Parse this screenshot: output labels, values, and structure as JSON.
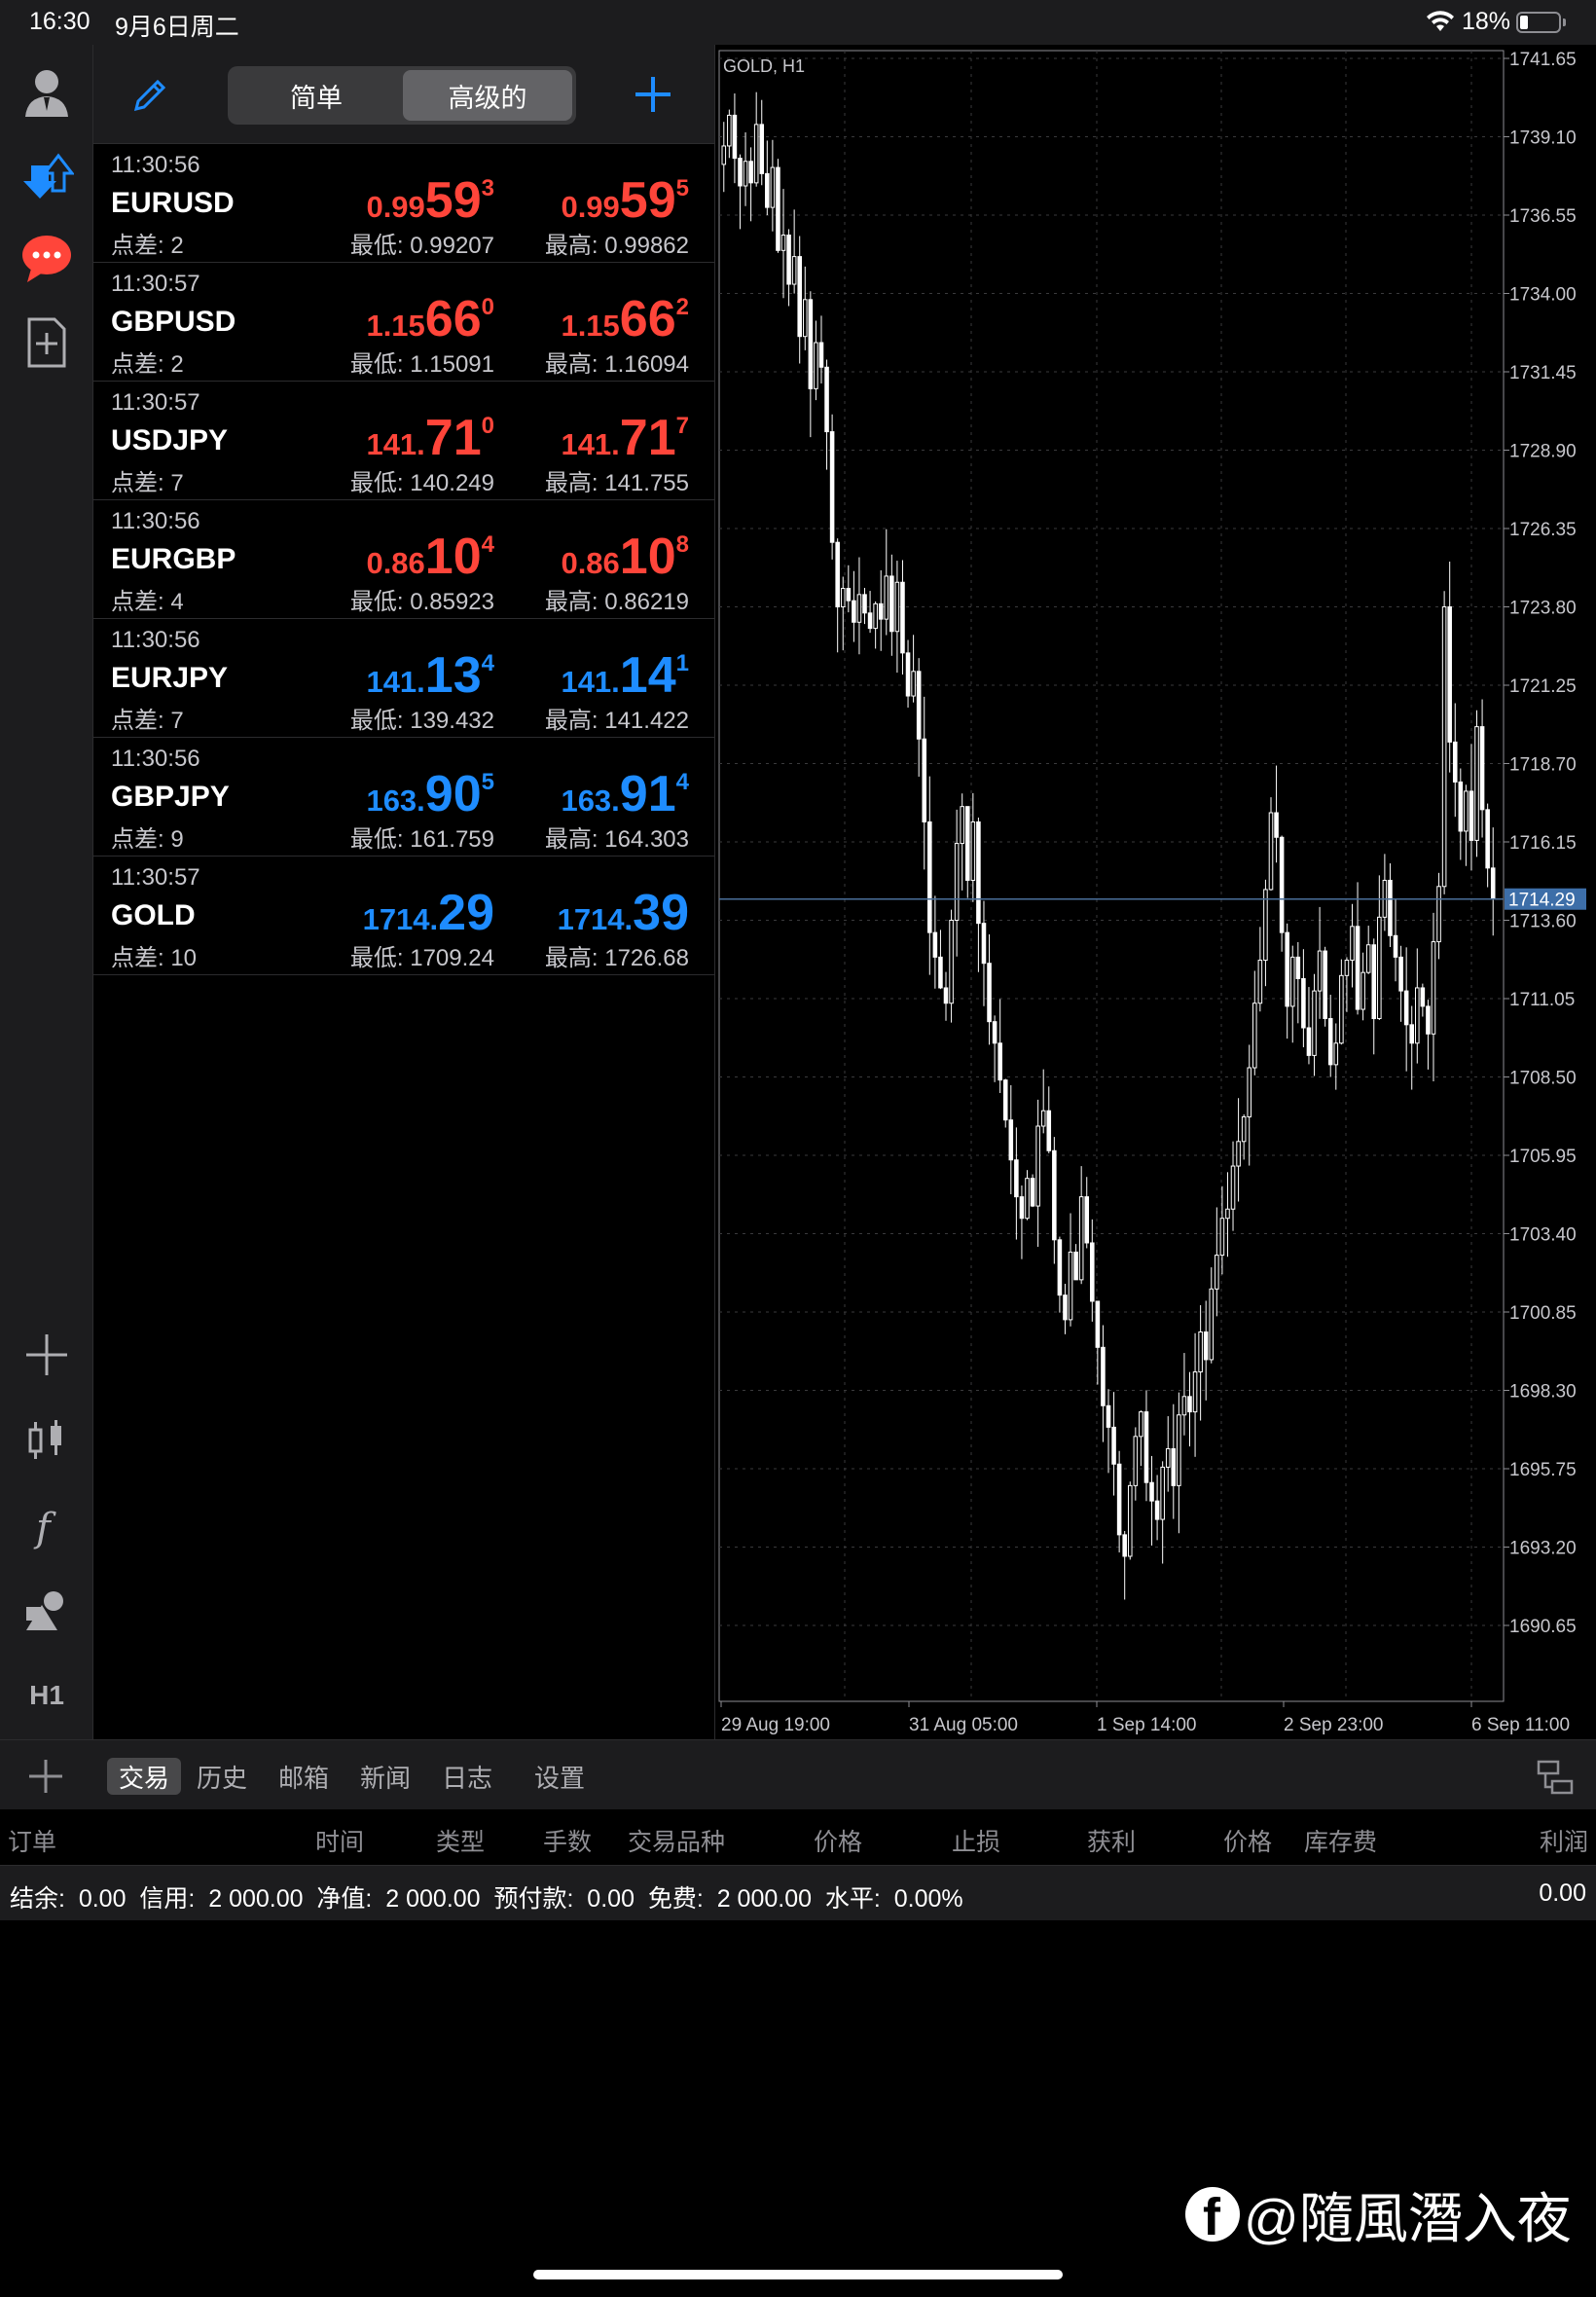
{
  "status": {
    "time": "16:30",
    "date": "9月6日周二",
    "battery": "18%"
  },
  "left_toolbar": {
    "timeframe": "H1"
  },
  "quotes_header": {
    "seg_simple": "简单",
    "seg_advanced": "高级的"
  },
  "quotes": [
    {
      "time": "11:30:56",
      "symbol": "EURUSD",
      "spread": "点差: 2",
      "color": "#ff453a",
      "bid": {
        "pre": "0.99",
        "big": "59",
        "sup": "3"
      },
      "ask": {
        "pre": "0.99",
        "big": "59",
        "sup": "5"
      },
      "low": "最低: 0.99207",
      "high": "最高: 0.99862"
    },
    {
      "time": "11:30:57",
      "symbol": "GBPUSD",
      "spread": "点差: 2",
      "color": "#ff453a",
      "bid": {
        "pre": "1.15",
        "big": "66",
        "sup": "0"
      },
      "ask": {
        "pre": "1.15",
        "big": "66",
        "sup": "2"
      },
      "low": "最低: 1.15091",
      "high": "最高: 1.16094"
    },
    {
      "time": "11:30:57",
      "symbol": "USDJPY",
      "spread": "点差: 7",
      "color": "#ff453a",
      "bid": {
        "pre": "141.",
        "big": "71",
        "sup": "0"
      },
      "ask": {
        "pre": "141.",
        "big": "71",
        "sup": "7"
      },
      "low": "最低: 140.249",
      "high": "最高: 141.755"
    },
    {
      "time": "11:30:56",
      "symbol": "EURGBP",
      "spread": "点差: 4",
      "color": "#ff453a",
      "bid": {
        "pre": "0.86",
        "big": "10",
        "sup": "4"
      },
      "ask": {
        "pre": "0.86",
        "big": "10",
        "sup": "8"
      },
      "low": "最低: 0.85923",
      "high": "最高: 0.86219"
    },
    {
      "time": "11:30:56",
      "symbol": "EURJPY",
      "spread": "点差: 7",
      "color": "#1e8cff",
      "bid": {
        "pre": "141.",
        "big": "13",
        "sup": "4"
      },
      "ask": {
        "pre": "141.",
        "big": "14",
        "sup": "1"
      },
      "low": "最低: 139.432",
      "high": "最高: 141.422"
    },
    {
      "time": "11:30:56",
      "symbol": "GBPJPY",
      "spread": "点差: 9",
      "color": "#1e8cff",
      "bid": {
        "pre": "163.",
        "big": "90",
        "sup": "5"
      },
      "ask": {
        "pre": "163.",
        "big": "91",
        "sup": "4"
      },
      "low": "最低: 161.759",
      "high": "最高: 164.303"
    },
    {
      "time": "11:30:57",
      "symbol": "GOLD",
      "spread": "点差: 10",
      "color": "#1e8cff",
      "bid": {
        "pre": "1714.",
        "big": "29",
        "sup": ""
      },
      "ask": {
        "pre": "1714.",
        "big": "39",
        "sup": ""
      },
      "low": "最低: 1709.24",
      "high": "最高: 1726.68"
    }
  ],
  "chart_data": {
    "type": "candlestick",
    "title": "GOLD, H1",
    "symbol": "GOLD",
    "timeframe": "H1",
    "current_price": "1714.29",
    "y_ticks": [
      "1741.65",
      "1739.10",
      "1736.55",
      "1734.00",
      "1731.45",
      "1728.90",
      "1726.35",
      "1723.80",
      "1721.25",
      "1718.70",
      "1716.15",
      "1713.60",
      "1711.05",
      "1708.50",
      "1705.95",
      "1703.40",
      "1700.85",
      "1698.30",
      "1695.75",
      "1693.20",
      "1690.65"
    ],
    "x_ticks": [
      "29 Aug 19:00",
      "31 Aug 05:00",
      "1 Sep 14:00",
      "2 Sep 23:00",
      "6 Sep 11:00"
    ],
    "ylim": [
      1688.1,
      1741.65
    ],
    "close_path": [
      1738.8,
      1739.8,
      1738.4,
      1737.5,
      1738.3,
      1737.6,
      1739.5,
      1737.9,
      1736.8,
      1738.1,
      1735.4,
      1735.9,
      1734.3,
      1735.2,
      1732.6,
      1733.8,
      1730.9,
      1732.4,
      1731.6,
      1729.5,
      1725.9,
      1723.8,
      1724.4,
      1724.0,
      1723.3,
      1724.2,
      1723.6,
      1723.1,
      1723.9,
      1723.4,
      1724.8,
      1723.0,
      1724.6,
      1722.3,
      1720.9,
      1721.7,
      1719.5,
      1716.8,
      1713.2,
      1712.4,
      1711.4,
      1710.9,
      1713.6,
      1716.1,
      1717.3,
      1714.9,
      1716.8,
      1713.5,
      1712.2,
      1710.3,
      1709.6,
      1708.4,
      1707.1,
      1705.8,
      1704.6,
      1703.9,
      1705.2,
      1704.3,
      1706.9,
      1707.4,
      1706.1,
      1703.2,
      1701.4,
      1700.6,
      1702.8,
      1701.9,
      1704.6,
      1703.1,
      1701.2,
      1699.7,
      1697.8,
      1697.1,
      1695.9,
      1693.6,
      1692.9,
      1695.2,
      1696.8,
      1697.6,
      1695.3,
      1694.7,
      1694.1,
      1695.8,
      1696.4,
      1695.2,
      1697.5,
      1698.1,
      1697.6,
      1698.9,
      1700.2,
      1699.3,
      1701.6,
      1702.7,
      1703.9,
      1704.2,
      1705.6,
      1706.4,
      1707.2,
      1708.8,
      1710.9,
      1712.3,
      1714.6,
      1717.1,
      1716.3,
      1713.2,
      1710.8,
      1712.4,
      1711.7,
      1710.1,
      1709.2,
      1711.3,
      1712.6,
      1710.4,
      1708.9,
      1709.6,
      1711.8,
      1712.3,
      1713.4,
      1710.7,
      1711.9,
      1712.8,
      1710.4,
      1713.7,
      1714.9,
      1713.1,
      1712.4,
      1711.3,
      1710.2,
      1709.6,
      1711.4,
      1710.8,
      1709.9,
      1712.9,
      1714.7,
      1723.8,
      1719.4,
      1718.1,
      1716.5,
      1717.8,
      1716.2,
      1719.9,
      1717.2,
      1715.3,
      1714.29
    ],
    "grid": true,
    "y_axis_side": "right"
  },
  "toolbox": {
    "tabs": [
      "交易",
      "历史",
      "邮箱",
      "新闻",
      "日志",
      "设置"
    ],
    "columns": [
      "订单",
      "时间",
      "类型",
      "手数",
      "交易品种",
      "价格",
      "止损",
      "获利",
      "价格",
      "库存费",
      "利润"
    ],
    "balance_line": "结余:  0.00  信用:  2 000.00  净值:  2 000.00  预付款:  0.00  免费:  2 000.00  水平:  0.00%",
    "profit_total": "0.00"
  },
  "watermark": "@隨風潛入夜"
}
